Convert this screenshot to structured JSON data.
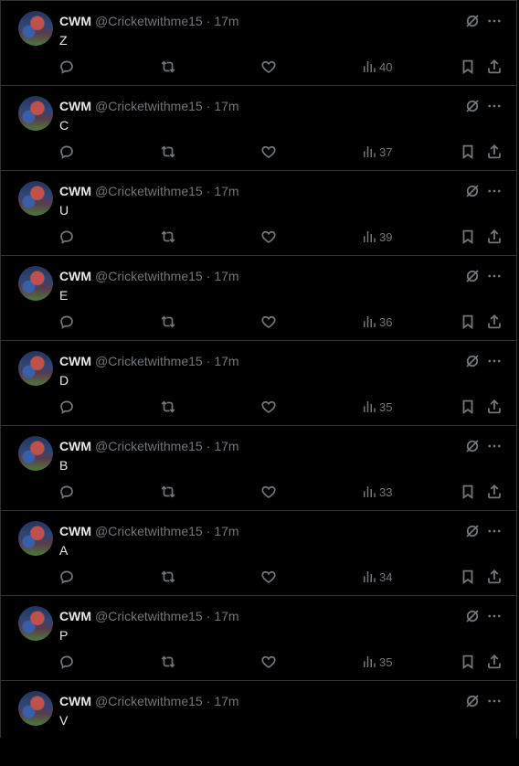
{
  "tweets": [
    {
      "name": "CWM",
      "handle": "@Cricketwithme15",
      "separator": "·",
      "time": "17m",
      "text": "Z",
      "views": "40"
    },
    {
      "name": "CWM",
      "handle": "@Cricketwithme15",
      "separator": "·",
      "time": "17m",
      "text": "C",
      "views": "37"
    },
    {
      "name": "CWM",
      "handle": "@Cricketwithme15",
      "separator": "·",
      "time": "17m",
      "text": "U",
      "views": "39"
    },
    {
      "name": "CWM",
      "handle": "@Cricketwithme15",
      "separator": "·",
      "time": "17m",
      "text": "E",
      "views": "36"
    },
    {
      "name": "CWM",
      "handle": "@Cricketwithme15",
      "separator": "·",
      "time": "17m",
      "text": "D",
      "views": "35"
    },
    {
      "name": "CWM",
      "handle": "@Cricketwithme15",
      "separator": "·",
      "time": "17m",
      "text": "B",
      "views": "33"
    },
    {
      "name": "CWM",
      "handle": "@Cricketwithme15",
      "separator": "·",
      "time": "17m",
      "text": "A",
      "views": "34"
    },
    {
      "name": "CWM",
      "handle": "@Cricketwithme15",
      "separator": "·",
      "time": "17m",
      "text": "P",
      "views": "35"
    },
    {
      "name": "CWM",
      "handle": "@Cricketwithme15",
      "separator": "·",
      "time": "17m",
      "text": "V"
    }
  ],
  "icons": {
    "grok": "grok-icon",
    "more": "more-icon",
    "reply": "reply-icon",
    "retweet": "retweet-icon",
    "like": "like-icon",
    "views": "views-icon",
    "bookmark": "bookmark-icon",
    "share": "share-icon"
  },
  "colors": {
    "background": "#000000",
    "text_primary": "#e7e9ea",
    "text_secondary": "#71767b",
    "divider": "#2f3336"
  }
}
